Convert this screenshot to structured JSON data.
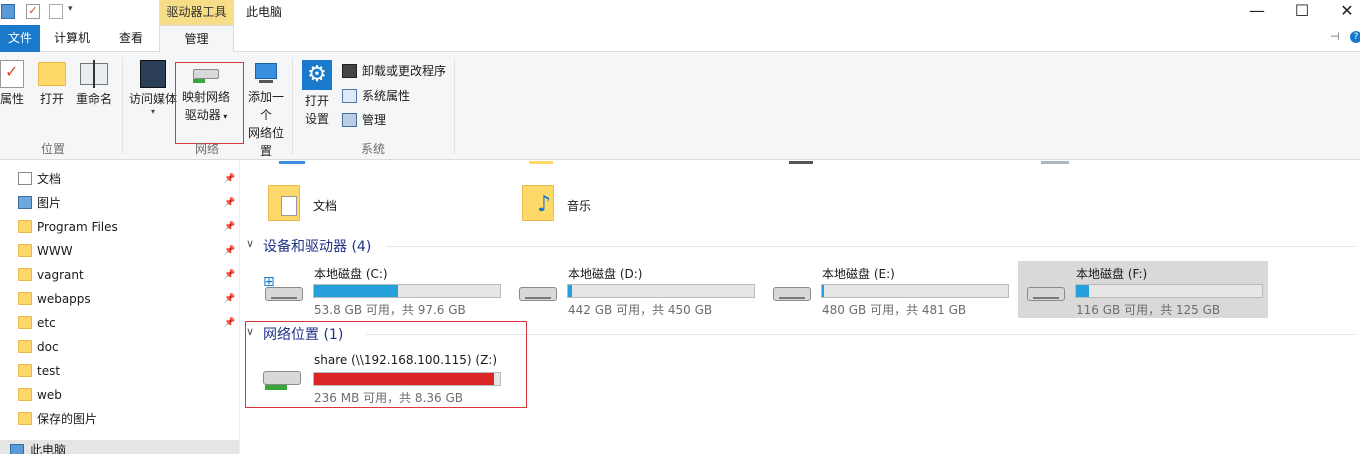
{
  "titlebar": {
    "context_tab": "驱动器工具",
    "window_title": "此电脑",
    "minimize": "—",
    "maximize": "☐",
    "close": "✕"
  },
  "tabs": {
    "file": "文件",
    "computer": "计算机",
    "view": "查看",
    "manage": "管理"
  },
  "ribbon": {
    "location_group": {
      "label": "位置",
      "properties": "属性",
      "open": "打开",
      "rename": "重命名"
    },
    "network_group": {
      "label": "网络",
      "access_media": "访问媒体",
      "map_drive_line1": "映射网络",
      "map_drive_line2": "驱动器",
      "add_location_line1": "添加一个",
      "add_location_line2": "网络位置"
    },
    "system_group": {
      "label": "系统",
      "open_settings_line1": "打开",
      "open_settings_line2": "设置",
      "uninstall": "卸载或更改程序",
      "system_properties": "系统属性",
      "manage": "管理"
    }
  },
  "nav": {
    "items": [
      {
        "label": "文档",
        "icon": "document-icon"
      },
      {
        "label": "图片",
        "icon": "pictures-icon"
      },
      {
        "label": "Program Files",
        "icon": "folder-icon"
      },
      {
        "label": "WWW",
        "icon": "folder-icon"
      },
      {
        "label": "vagrant",
        "icon": "folder-icon"
      },
      {
        "label": "webapps",
        "icon": "folder-icon"
      },
      {
        "label": "etc",
        "icon": "folder-icon"
      },
      {
        "label": "doc",
        "icon": "folder-icon"
      },
      {
        "label": "test",
        "icon": "folder-icon"
      },
      {
        "label": "web",
        "icon": "folder-icon"
      },
      {
        "label": "保存的图片",
        "icon": "folder-icon"
      }
    ],
    "this_pc": "此电脑"
  },
  "main": {
    "folders": [
      {
        "label": "文档"
      },
      {
        "label": "音乐"
      }
    ],
    "devices_header": "设备和驱动器 (4)",
    "drives": [
      {
        "name": "本地磁盘 (C:)",
        "info": "53.8 GB 可用，共 97.6 GB",
        "used_fraction": 0.45
      },
      {
        "name": "本地磁盘 (D:)",
        "info": "442 GB 可用，共 450 GB",
        "used_fraction": 0.02
      },
      {
        "name": "本地磁盘 (E:)",
        "info": "480 GB 可用，共 481 GB",
        "used_fraction": 0.01
      },
      {
        "name": "本地磁盘 (F:)",
        "info": "116 GB 可用，共 125 GB",
        "used_fraction": 0.07
      }
    ],
    "network_header": "网络位置 (1)",
    "network_drive": {
      "name": "share (\\\\192.168.100.115) (Z:)",
      "info": "236 MB 可用，共 8.36 GB",
      "used_fraction": 0.97
    },
    "colors": {
      "bar_blue": "#26a0da",
      "bar_red": "#da2626",
      "highlight_box": "#d9363e",
      "context_tab": "#f7dd87",
      "file_tab": "#1979ca"
    }
  }
}
